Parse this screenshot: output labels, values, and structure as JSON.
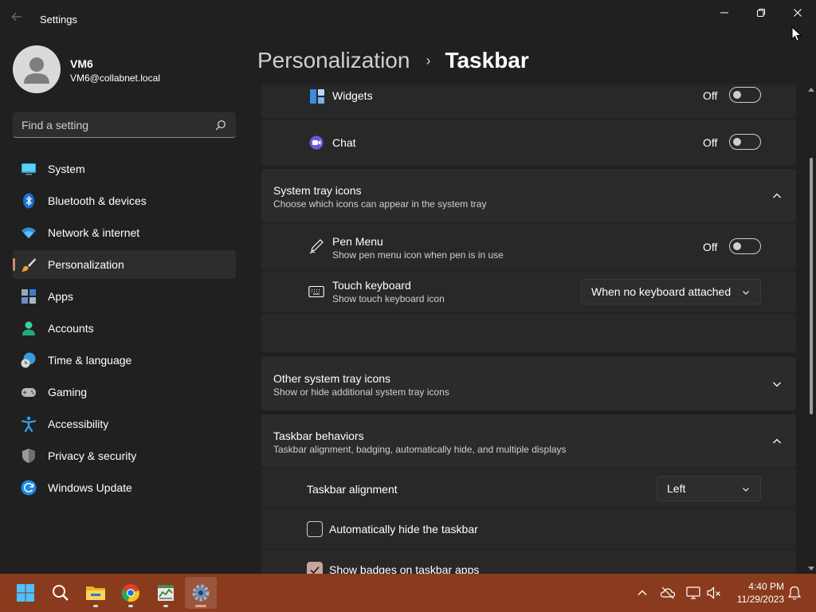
{
  "window": {
    "title": "Settings"
  },
  "user": {
    "name": "VM6",
    "email": "VM6@collabnet.local"
  },
  "search": {
    "placeholder": "Find a setting",
    "value": ""
  },
  "nav": {
    "items": [
      {
        "label": "System",
        "icon": "monitor-icon",
        "selected": false
      },
      {
        "label": "Bluetooth & devices",
        "icon": "bluetooth-icon",
        "selected": false
      },
      {
        "label": "Network & internet",
        "icon": "wifi-icon",
        "selected": false
      },
      {
        "label": "Personalization",
        "icon": "paintbrush-icon",
        "selected": true
      },
      {
        "label": "Apps",
        "icon": "apps-icon",
        "selected": false
      },
      {
        "label": "Accounts",
        "icon": "person-icon",
        "selected": false
      },
      {
        "label": "Time & language",
        "icon": "clock-globe-icon",
        "selected": false
      },
      {
        "label": "Gaming",
        "icon": "gamepad-icon",
        "selected": false
      },
      {
        "label": "Accessibility",
        "icon": "accessibility-icon",
        "selected": false
      },
      {
        "label": "Privacy & security",
        "icon": "shield-icon",
        "selected": false
      },
      {
        "label": "Windows Update",
        "icon": "update-icon",
        "selected": false
      }
    ]
  },
  "breadcrumb": {
    "parent": "Personalization",
    "separator": "›",
    "current": "Taskbar"
  },
  "content": {
    "widgets": {
      "label": "Widgets",
      "state": "Off",
      "on": false
    },
    "chat": {
      "label": "Chat",
      "state": "Off",
      "on": false
    },
    "system_tray": {
      "title": "System tray icons",
      "desc": "Choose which icons can appear in the system tray",
      "expanded": true,
      "pen_menu": {
        "label": "Pen Menu",
        "desc": "Show pen menu icon when pen is in use",
        "state": "Off",
        "on": false
      },
      "touch_keyboard": {
        "label": "Touch keyboard",
        "desc": "Show touch keyboard icon",
        "value": "When no keyboard attached"
      }
    },
    "other_tray": {
      "title": "Other system tray icons",
      "desc": "Show or hide additional system tray icons",
      "expanded": false
    },
    "behaviors": {
      "title": "Taskbar behaviors",
      "desc": "Taskbar alignment, badging, automatically hide, and multiple displays",
      "expanded": true,
      "alignment": {
        "label": "Taskbar alignment",
        "value": "Left"
      },
      "auto_hide": {
        "label": "Automatically hide the taskbar",
        "checked": false
      },
      "badges": {
        "label": "Show badges on taskbar apps",
        "checked": true
      }
    }
  },
  "taskbar": {
    "apps": [
      "start-icon",
      "search-icon",
      "file-explorer-icon",
      "chrome-icon",
      "task-manager-icon",
      "settings-icon"
    ],
    "clock": {
      "time": "4:40 PM",
      "date": "11/29/2023"
    }
  },
  "colors": {
    "accent": "#d08a6a",
    "taskbar": "#8a3b1d",
    "background": "#202020",
    "card": "#2b2b2b"
  }
}
